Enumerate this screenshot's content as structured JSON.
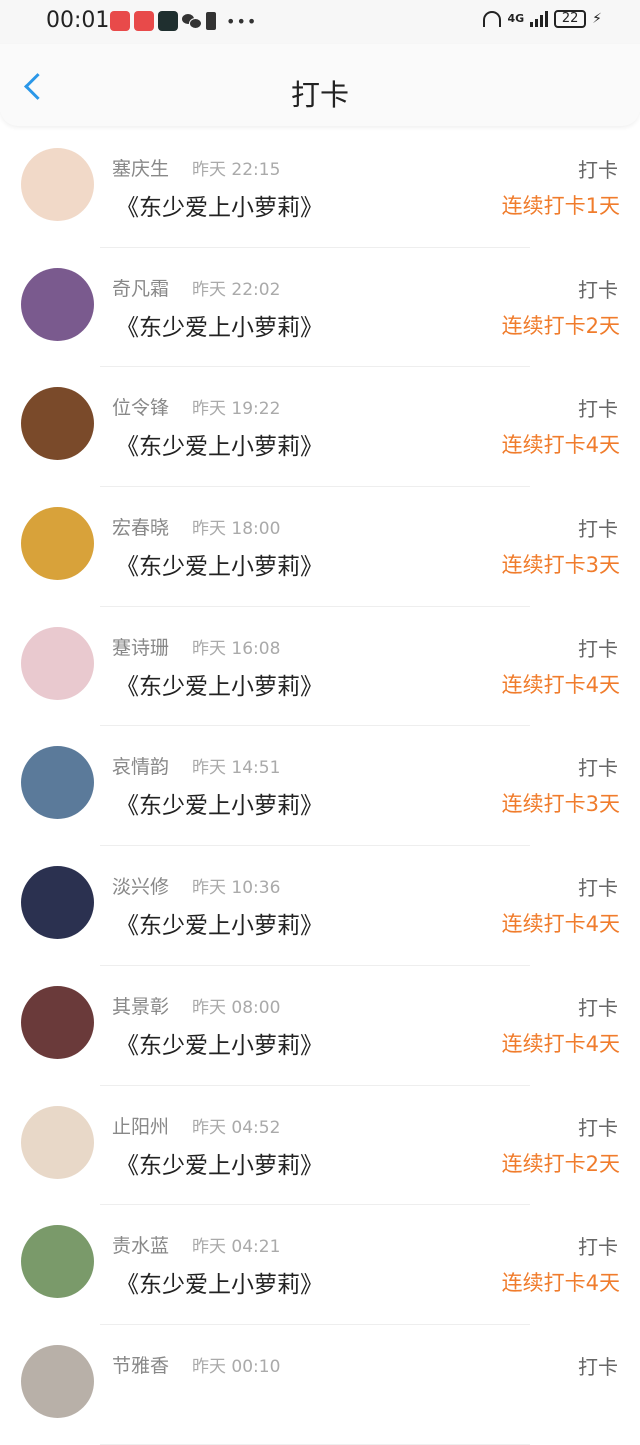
{
  "status_bar": {
    "time": "00:01",
    "network": "4G",
    "battery": "22"
  },
  "header": {
    "title": "打卡"
  },
  "checkins": [
    {
      "name": "塞庆生",
      "time": "昨天 22:15",
      "book": "《东少爱上小萝莉》",
      "action": "打卡",
      "streak": "连续打卡1天",
      "avatar_color": "#f1d9c8"
    },
    {
      "name": "奇凡霜",
      "time": "昨天 22:02",
      "book": "《东少爱上小萝莉》",
      "action": "打卡",
      "streak": "连续打卡2天",
      "avatar_color": "#7a5a8e"
    },
    {
      "name": "位令锋",
      "time": "昨天 19:22",
      "book": "《东少爱上小萝莉》",
      "action": "打卡",
      "streak": "连续打卡4天",
      "avatar_color": "#7a4a2a"
    },
    {
      "name": "宏春晓",
      "time": "昨天 18:00",
      "book": "《东少爱上小萝莉》",
      "action": "打卡",
      "streak": "连续打卡3天",
      "avatar_color": "#d8a23a"
    },
    {
      "name": "蹇诗珊",
      "time": "昨天 16:08",
      "book": "《东少爱上小萝莉》",
      "action": "打卡",
      "streak": "连续打卡4天",
      "avatar_color": "#e9c9cf"
    },
    {
      "name": "哀情韵",
      "time": "昨天 14:51",
      "book": "《东少爱上小萝莉》",
      "action": "打卡",
      "streak": "连续打卡3天",
      "avatar_color": "#5b7a9a"
    },
    {
      "name": "淡兴修",
      "time": "昨天 10:36",
      "book": "《东少爱上小萝莉》",
      "action": "打卡",
      "streak": "连续打卡4天",
      "avatar_color": "#2b3150"
    },
    {
      "name": "其景彰",
      "time": "昨天 08:00",
      "book": "《东少爱上小萝莉》",
      "action": "打卡",
      "streak": "连续打卡4天",
      "avatar_color": "#6a3a3a"
    },
    {
      "name": "止阳州",
      "time": "昨天 04:52",
      "book": "《东少爱上小萝莉》",
      "action": "打卡",
      "streak": "连续打卡2天",
      "avatar_color": "#e8d8c8"
    },
    {
      "name": "责水蓝",
      "time": "昨天 04:21",
      "book": "《东少爱上小萝莉》",
      "action": "打卡",
      "streak": "连续打卡4天",
      "avatar_color": "#7a9a6a"
    },
    {
      "name": "节雅香",
      "time": "昨天 00:10",
      "book": "",
      "action": "打卡",
      "streak": "",
      "avatar_color": "#b8b0a8"
    }
  ]
}
